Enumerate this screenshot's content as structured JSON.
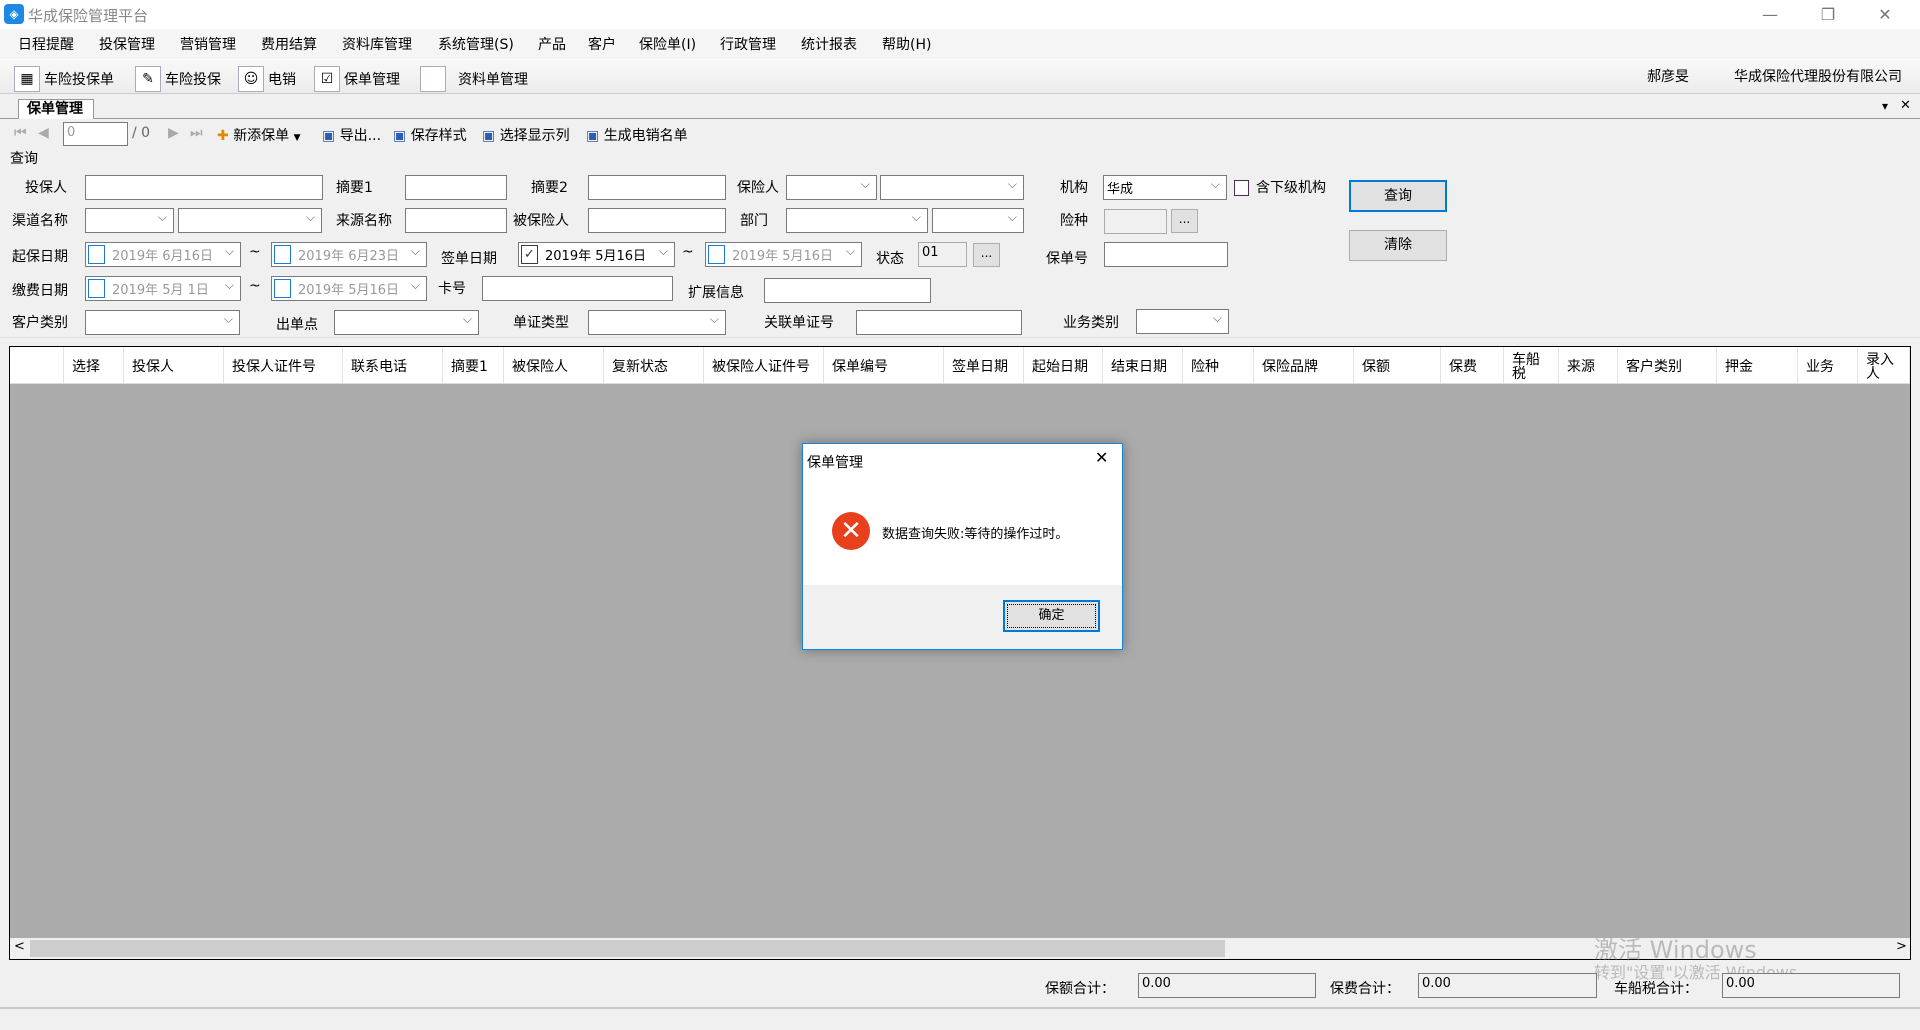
{
  "window": {
    "title": "华成保险管理平台",
    "minimize": "—",
    "restore": "❐",
    "close": "✕"
  },
  "menu": [
    "日程提醒",
    "投保管理",
    "营销管理",
    "费用结算",
    "资料库管理",
    "系统管理(S)",
    "产品",
    "客户",
    "保险单(I)",
    "行政管理",
    "统计报表",
    "帮助(H)"
  ],
  "toolbar": {
    "items": [
      {
        "label": "车险投保单",
        "icon": "calculator-icon"
      },
      {
        "label": "车险投保",
        "icon": "document-edit-icon"
      },
      {
        "label": "电销",
        "icon": "contact-card-icon"
      },
      {
        "label": "保单管理",
        "icon": "checklist-icon"
      },
      {
        "label": "资料单管理",
        "icon": "blank-document-icon"
      }
    ],
    "user": "郝彦旻",
    "company": "华成保险代理股份有限公司"
  },
  "tab": {
    "label": "保单管理",
    "menu_glyph": "▾",
    "close_glyph": "✕"
  },
  "nav": {
    "page_value": "0",
    "page_total": "/ 0",
    "add": "新添保单",
    "export": "导出...",
    "save_style": "保存样式",
    "choose_columns": "选择显示列",
    "gen_list": "生成电销名单"
  },
  "query": {
    "section": "查询",
    "policyholder": "投保人",
    "summary1": "摘要1",
    "summary2": "摘要2",
    "insurer": "保险人",
    "org": "机构",
    "org_value": "华成",
    "include_sub": "含下级机构",
    "query_btn": "查询",
    "channel": "渠道名称",
    "source": "来源名称",
    "insured": "被保险人",
    "dept": "部门",
    "ins_type": "险种",
    "clear_btn": "清除",
    "start_date": "起保日期",
    "start_from": "2019年  6月16日",
    "start_to": "2019年  6月23日",
    "tilde": "~",
    "sign_date": "签单日期",
    "sign_from": "2019年  5月16日",
    "sign_to": "2019年  5月16日",
    "status": "状态",
    "status_value": "01",
    "policy_no": "保单号",
    "pay_date": "缴费日期",
    "pay_from": "2019年  5月  1日",
    "pay_to": "2019年  5月16日",
    "card_no": "卡号",
    "ext_info": "扩展信息",
    "cust_type": "客户类别",
    "issue_point": "出单点",
    "doc_type": "单证类型",
    "related_doc": "关联单证号",
    "biz_type": "业务类别",
    "ellipsis": "..."
  },
  "grid": {
    "columns": [
      "",
      "选择",
      "投保人",
      "投保人证件号",
      "联系电话",
      "摘要1",
      "被保险人",
      "复新状态",
      "被保险人证件号",
      "保单编号",
      "签单日期",
      "起始日期",
      "结束日期",
      "险种",
      "保险品牌",
      "保额",
      "保费",
      "车船税",
      "来源",
      "客户类别",
      "押金",
      "业务",
      "录入人"
    ],
    "scroll_left": "<",
    "scroll_right": ">"
  },
  "totals": {
    "amount_label": "保额合计：",
    "amount": "0.00",
    "premium_label": "保费合计：",
    "premium": "0.00",
    "tax_label": "车船税合计：",
    "tax": "0.00"
  },
  "watermark": {
    "line1": "激活 Windows",
    "line2": "转到\"设置\"以激活 Windows。"
  },
  "dialog": {
    "title": "保单管理",
    "message": "数据查询失败:等待的操作过时。",
    "ok": "确定",
    "close": "✕",
    "icon": "error-icon"
  },
  "colors": {
    "accent": "#0078d7",
    "error": "#e8401c",
    "grid_bg": "#ababab"
  }
}
